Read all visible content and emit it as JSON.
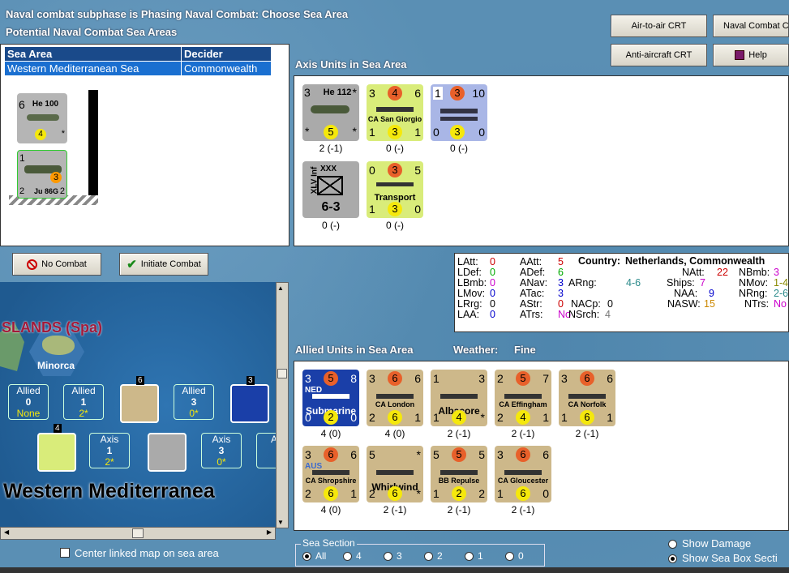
{
  "header": {
    "phase": "Naval combat subphase is Phasing Naval Combat: Choose Sea Area",
    "potential": "Potential Naval Combat Sea Areas",
    "axis_units": "Axis Units in Sea Area",
    "allied_units": "Allied Units in Sea Area",
    "weather_label": "Weather:",
    "weather": "Fine"
  },
  "buttons": {
    "air_crt": "Air-to-air CRT",
    "naval_crt": "Naval Combat Ch",
    "aa_crt": "Anti-aircraft CRT",
    "help": "Help",
    "no_combat": "No Combat",
    "initiate": "Initiate Combat"
  },
  "sea_table": {
    "headers": [
      "Sea Area",
      "Decider"
    ],
    "rows": [
      [
        "Western Mediterranean Sea",
        "Commonwealth"
      ]
    ]
  },
  "mini_counters": [
    {
      "name": "He 100",
      "tl": "6",
      "circ": "4",
      "br": "*"
    },
    {
      "name": "Ju 86G",
      "tl": "1",
      "circ": "3",
      "bl": "2",
      "br": "2"
    }
  ],
  "axis": [
    {
      "name": "He 112",
      "tl": "3",
      "tr": "*",
      "bl": "*",
      "bc": "5",
      "br": "*",
      "cap": "2 (-1)"
    },
    {
      "name": "CA San Giorgio",
      "tl": "3",
      "tc": "4",
      "tr": "6",
      "bl": "1",
      "bc": "3",
      "br": "1",
      "cap": "0 (-)"
    },
    {
      "name": "",
      "tl": "1",
      "tc": "3",
      "tr": "10",
      "bl": "0",
      "bc": "3",
      "br": "0",
      "cap": "0 (-)"
    },
    {
      "name": "XLV Inf",
      "tl": "XXX",
      "bc": "6-3",
      "cap": "0 (-)"
    },
    {
      "name": "Transport",
      "tl": "0",
      "tc": "3",
      "tr": "5",
      "bl": "1",
      "bc": "3",
      "br": "0",
      "cap": "0 (-)"
    }
  ],
  "allied": [
    {
      "name": "Submarine",
      "flag": "NED",
      "tl": "3",
      "tc": "5",
      "tr": "8",
      "bl": "0",
      "bc": "2",
      "br": "0",
      "cap": "4 (0)"
    },
    {
      "name": "CA London",
      "tl": "3",
      "tc": "6",
      "tr": "6",
      "bl": "2",
      "bc": "6",
      "br": "1",
      "cap": "4 (0)"
    },
    {
      "name": "Albacore",
      "tl": "1",
      "tr": "3",
      "bc": "4",
      "bl": "1",
      "br": "*",
      "cap": "2 (-1)"
    },
    {
      "name": "CA Effingham",
      "tl": "2",
      "tc": "5",
      "tr": "7",
      "bl": "2",
      "bc": "4",
      "br": "1",
      "cap": "2 (-1)"
    },
    {
      "name": "CA Norfolk",
      "tl": "3",
      "tc": "6",
      "tr": "6",
      "bl": "1",
      "bc": "6",
      "br": "1",
      "cap": "2 (-1)"
    },
    {
      "name": "CA Shropshire",
      "flag": "AUS",
      "tl": "3",
      "tc": "6",
      "tr": "6",
      "bl": "2",
      "bc": "6",
      "br": "1",
      "cap": "4 (0)"
    },
    {
      "name": "Whirlwind",
      "tl": "5",
      "tr": "*",
      "bl": "2",
      "bc": "6",
      "br": "*",
      "cap": "2 (-1)"
    },
    {
      "name": "BB Repulse",
      "tl": "5",
      "tc": "5",
      "tr": "5",
      "bl": "1",
      "bc": "2",
      "br": "2",
      "cap": "2 (-1)"
    },
    {
      "name": "CA Gloucester",
      "tl": "3",
      "tc": "6",
      "tr": "6",
      "bl": "1",
      "bc": "6",
      "br": "0",
      "cap": "2 (-1)"
    }
  ],
  "stats": {
    "country_label": "Country:",
    "country": "Netherlands, Commonwealth",
    "cells": [
      [
        "LAtt:",
        "0"
      ],
      [
        "LDef:",
        "0"
      ],
      [
        "LBmb:",
        "0"
      ],
      [
        "LMov:",
        "0"
      ],
      [
        "LRrg:",
        "0"
      ],
      [
        "LAA:",
        "0"
      ],
      [
        "AAtt:",
        "5"
      ],
      [
        "ADef:",
        "6"
      ],
      [
        "ANav:",
        "3"
      ],
      [
        "ATac:",
        "3"
      ],
      [
        "AStr:",
        "0"
      ],
      [
        "ATrs:",
        "No"
      ],
      [
        "ARng:",
        "4-6"
      ],
      [
        "NACp:",
        "0"
      ],
      [
        "NSrch:",
        "4"
      ],
      [
        "NAtt:",
        "22"
      ],
      [
        "Ships:",
        "7"
      ],
      [
        "NAA:",
        "9"
      ],
      [
        "NASW:",
        "15"
      ],
      [
        "NBmb:",
        "3"
      ],
      [
        "NMov:",
        "1-4"
      ],
      [
        "NRng:",
        "2-6"
      ],
      [
        "NTrs:",
        "No"
      ]
    ]
  },
  "map": {
    "island": "SLANDS (Spa)",
    "minorca": "Minorca",
    "sea": "Western Mediterranea",
    "boxes": [
      {
        "side": "Allied",
        "num": "0",
        "val": "None"
      },
      {
        "side": "Allied",
        "num": "1",
        "val": "2*"
      },
      {
        "side": "Allied",
        "num": "3",
        "val": "0*"
      },
      {
        "side": "Axis",
        "num": "1",
        "val": "2*"
      },
      {
        "side": "Axis",
        "num": "3",
        "val": "0*"
      },
      {
        "side": "Ax",
        "num": "",
        "val": ""
      }
    ],
    "stack_counts": [
      "6",
      "3",
      "4"
    ],
    "center_label": "Center linked map on sea area"
  },
  "sea_section": {
    "label": "Sea Section",
    "options": [
      "All",
      "4",
      "3",
      "2",
      "1",
      "0"
    ],
    "selected": "All"
  },
  "display": {
    "show_damage": "Show Damage",
    "show_box": "Show Sea Box Secti"
  }
}
